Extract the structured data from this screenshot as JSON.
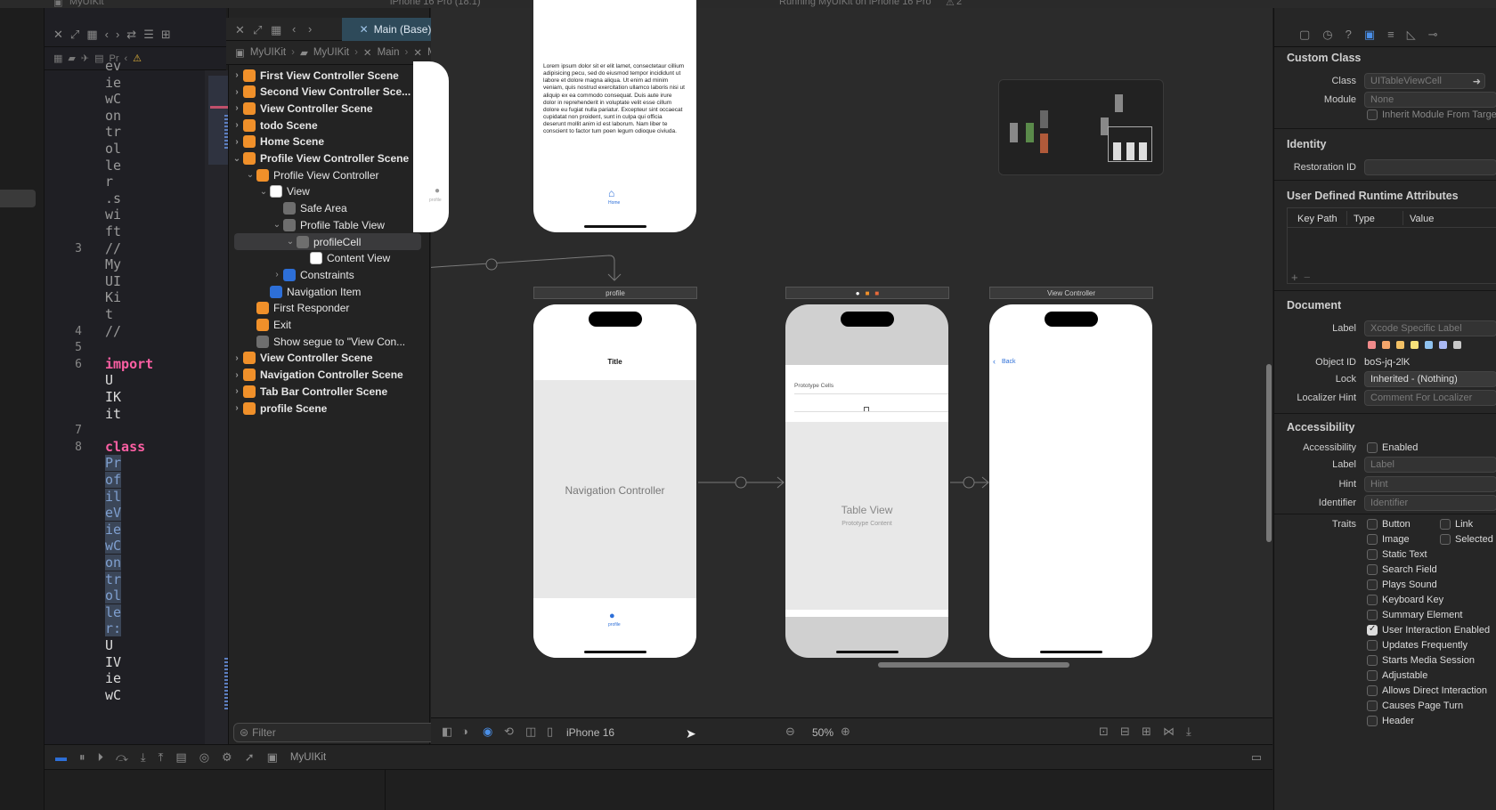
{
  "window": {
    "title": "MyUIKit",
    "status_text": "Running MyUIKit on iPhone 16 Pro",
    "device_title": "iPhone 16 Pro (18.1)",
    "warnings_count": "2"
  },
  "editor": {
    "lines": [
      {
        "num": "",
        "text": "ev"
      },
      {
        "num": "",
        "text": "ie"
      },
      {
        "num": "",
        "text": "wC"
      },
      {
        "num": "",
        "text": "on"
      },
      {
        "num": "",
        "text": "tr"
      },
      {
        "num": "",
        "text": "ol"
      },
      {
        "num": "",
        "text": "le"
      },
      {
        "num": "",
        "text": "r"
      },
      {
        "num": "",
        "text": ".s"
      },
      {
        "num": "",
        "text": "wi"
      },
      {
        "num": "",
        "text": "ft"
      },
      {
        "num": "3",
        "text": "//"
      },
      {
        "num": "",
        "text": "My"
      },
      {
        "num": "",
        "text": "UI"
      },
      {
        "num": "",
        "text": "Ki"
      },
      {
        "num": "",
        "text": "t"
      },
      {
        "num": "4",
        "text": "//"
      },
      {
        "num": "5",
        "text": ""
      },
      {
        "num": "6",
        "text": "import"
      },
      {
        "num": "",
        "text": "U"
      },
      {
        "num": "",
        "text": "IK"
      },
      {
        "num": "",
        "text": "it"
      },
      {
        "num": "7",
        "text": ""
      },
      {
        "num": "8",
        "text": "class"
      },
      {
        "num": "",
        "text": "Pr"
      },
      {
        "num": "",
        "text": "of"
      },
      {
        "num": "",
        "text": "il"
      },
      {
        "num": "",
        "text": "eV"
      },
      {
        "num": "",
        "text": "ie"
      },
      {
        "num": "",
        "text": "wC"
      },
      {
        "num": "",
        "text": "on"
      },
      {
        "num": "",
        "text": "tr"
      },
      {
        "num": "",
        "text": "ol"
      },
      {
        "num": "",
        "text": "le"
      },
      {
        "num": "",
        "text": "r:"
      },
      {
        "num": "",
        "text": "U"
      },
      {
        "num": "",
        "text": "IV"
      },
      {
        "num": "",
        "text": "ie"
      },
      {
        "num": "",
        "text": "wC"
      }
    ],
    "breadcrumb_hint": "Pr"
  },
  "tabs": {
    "active": "Main (Base)"
  },
  "breadcrumb": [
    "MyUIKit",
    "MyUIKit",
    "Main",
    "Main (Base)",
    "View Controller Scene",
    "Profile View Controller",
    "View",
    "Profile Table View",
    "profileCell"
  ],
  "outline": {
    "rows": [
      {
        "label": "First View Controller Scene",
        "bold": true,
        "chev": "›",
        "icon": "orange",
        "indent": 0
      },
      {
        "label": "Second View Controller Sce...",
        "bold": true,
        "chev": "›",
        "icon": "orange",
        "indent": 0
      },
      {
        "label": "View Controller Scene",
        "bold": true,
        "chev": "›",
        "icon": "orange",
        "indent": 0
      },
      {
        "label": "todo Scene",
        "bold": true,
        "chev": "›",
        "icon": "orange",
        "indent": 0
      },
      {
        "label": "Home Scene",
        "bold": true,
        "chev": "›",
        "icon": "orange",
        "indent": 0
      },
      {
        "label": "Profile View Controller Scene",
        "bold": true,
        "chev": "⌄",
        "icon": "orange",
        "indent": 0
      },
      {
        "label": "Profile View Controller",
        "bold": false,
        "chev": "⌄",
        "icon": "orange",
        "indent": 1
      },
      {
        "label": "View",
        "bold": false,
        "chev": "⌄",
        "icon": "white",
        "indent": 2
      },
      {
        "label": "Safe Area",
        "bold": false,
        "chev": "",
        "icon": "gray",
        "indent": 3
      },
      {
        "label": "Profile Table View",
        "bold": false,
        "chev": "⌄",
        "icon": "gray",
        "indent": 3
      },
      {
        "label": "profileCell",
        "bold": false,
        "chev": "⌄",
        "icon": "gray",
        "indent": 4,
        "selected": true
      },
      {
        "label": "Content View",
        "bold": false,
        "chev": "",
        "icon": "white",
        "indent": 5
      },
      {
        "label": "Constraints",
        "bold": false,
        "chev": "›",
        "icon": "blue",
        "indent": 3
      },
      {
        "label": "Navigation Item",
        "bold": false,
        "chev": "",
        "icon": "blue",
        "indent": 2
      },
      {
        "label": "First Responder",
        "bold": false,
        "chev": "",
        "icon": "orange",
        "indent": 1
      },
      {
        "label": "Exit",
        "bold": false,
        "chev": "",
        "icon": "orange",
        "indent": 1
      },
      {
        "label": "Show segue to \"View Con...",
        "bold": false,
        "chev": "",
        "icon": "gray",
        "indent": 1
      },
      {
        "label": "View Controller Scene",
        "bold": true,
        "chev": "›",
        "icon": "orange",
        "indent": 0
      },
      {
        "label": "Navigation Controller Scene",
        "bold": true,
        "chev": "›",
        "icon": "orange",
        "indent": 0
      },
      {
        "label": "Tab Bar Controller Scene",
        "bold": true,
        "chev": "›",
        "icon": "orange",
        "indent": 0
      },
      {
        "label": "profile Scene",
        "bold": true,
        "chev": "›",
        "icon": "orange",
        "indent": 0
      }
    ],
    "filter_placeholder": "Filter"
  },
  "canvas": {
    "lorem": "Lorem ipsum dolor sit er elit lamet, consectetaur cillium adipisicing pecu, sed do eiusmod tempor incididunt ut labore et dolore magna aliqua. Ut enim ad minim veniam, quis nostrud exercitation ullamco laboris nisi ut aliquip ex ea commodo consequat. Duis aute irure dolor in reprehenderit in voluptate velit esse cillum dolore eu fugiat nulla pariatur. Excepteur sint occaecat cupidatat non proident, sunt in culpa qui officia deserunt mollit anim id est laborum. Nam liber te conscient to factor tum poen legum odioque civiuda.",
    "home_label": "Home",
    "profile_scene_label": "profile",
    "profile_left_label": "profile",
    "nav_title": "Title",
    "nav_controller_label": "Navigation Controller",
    "nav_tab_label": "profile",
    "prototype_cells": "Prototype Cells",
    "table_view_label": "Table View",
    "prototype_content": "Prototype Content",
    "view_controller_scene": "View Controller",
    "back_label": "Back",
    "device": "iPhone 16",
    "zoom": "50%"
  },
  "debugbar": {
    "scheme": "MyUIKit"
  },
  "inspector": {
    "custom_class_header": "Custom Class",
    "class_label": "Class",
    "class_value": "UITableViewCell",
    "module_label": "Module",
    "module_value": "None",
    "inherit_label": "Inherit Module From Target",
    "identity_header": "Identity",
    "restoration_label": "Restoration ID",
    "udra_header": "User Defined Runtime Attributes",
    "col_keypath": "Key Path",
    "col_type": "Type",
    "col_value": "Value",
    "document_header": "Document",
    "doc_label_label": "Label",
    "doc_label_placeholder": "Xcode Specific Label",
    "object_id_label": "Object ID",
    "object_id_value": "boS-jq-2lK",
    "lock_label": "Lock",
    "lock_value": "Inherited - (Nothing)",
    "localizer_label": "Localizer Hint",
    "localizer_placeholder": "Comment For Localizer",
    "accessibility_header": "Accessibility",
    "acc_label": "Accessibility",
    "acc_enabled": "Enabled",
    "acc_label_label": "Label",
    "acc_label_placeholder": "Label",
    "hint_label": "Hint",
    "hint_placeholder": "Hint",
    "identifier_label": "Identifier",
    "identifier_placeholder": "Identifier",
    "traits_label": "Traits",
    "traits": [
      {
        "label": "Button",
        "checked": false
      },
      {
        "label": "Link",
        "checked": false
      },
      {
        "label": "Image",
        "checked": false
      },
      {
        "label": "Selected",
        "checked": false
      },
      {
        "label": "Static Text",
        "checked": false
      },
      {
        "label": "Search Field",
        "checked": false
      },
      {
        "label": "Plays Sound",
        "checked": false
      },
      {
        "label": "Keyboard Key",
        "checked": false
      },
      {
        "label": "Summary Element",
        "checked": false
      },
      {
        "label": "User Interaction Enabled",
        "checked": true
      },
      {
        "label": "Updates Frequently",
        "checked": false
      },
      {
        "label": "Starts Media Session",
        "checked": false
      },
      {
        "label": "Adjustable",
        "checked": false
      },
      {
        "label": "Allows Direct Interaction",
        "checked": false
      },
      {
        "label": "Causes Page Turn",
        "checked": false
      },
      {
        "label": "Header",
        "checked": false
      }
    ],
    "label_colors": [
      "#f08a8a",
      "#f5a66b",
      "#f2c065",
      "#f6e27a",
      "#8fc2f0",
      "#a9b8f5",
      "#c8c8c8"
    ]
  }
}
